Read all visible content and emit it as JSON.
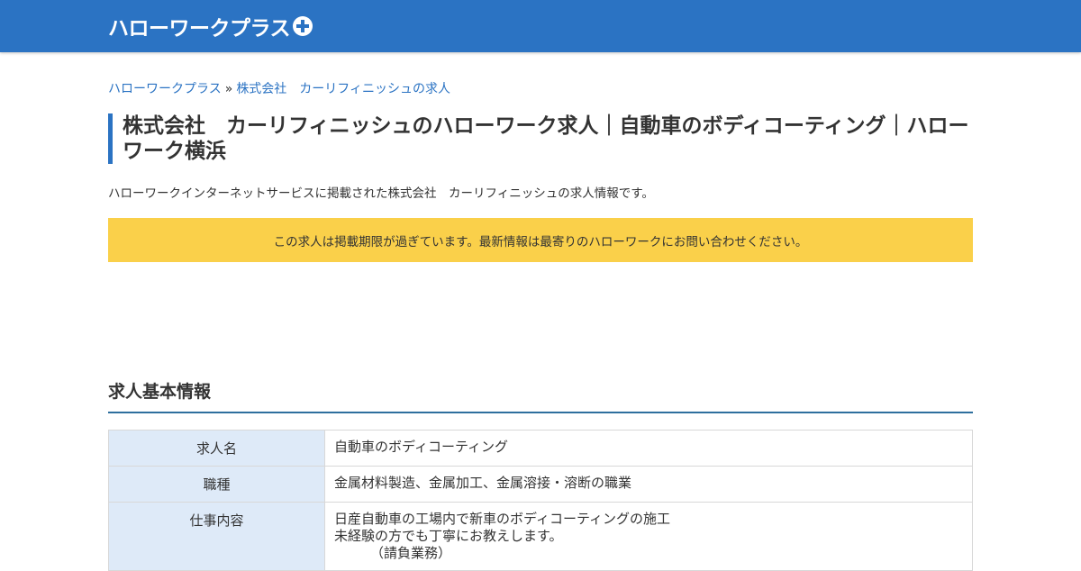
{
  "header": {
    "logo_text": "ハローワークプラス",
    "logo_icon": "plus-circle-icon",
    "brand_color": "#2b73c3"
  },
  "breadcrumb": {
    "home": "ハローワークプラス",
    "separator": "»",
    "current": "株式会社　カーリフィニッシュの求人"
  },
  "page": {
    "title": "株式会社　カーリフィニッシュのハローワーク求人｜自動車のボディコーティング｜ハローワーク横浜",
    "intro": "ハローワークインターネットサービスに掲載された株式会社　カーリフィニッシュの求人情報です。",
    "notice": "この求人は掲載期限が過ぎています。最新情報は最寄りのハローワークにお問い合わせください。",
    "notice_color": "#fad04a"
  },
  "section": {
    "heading": "求人基本情報"
  },
  "table": {
    "rows": [
      {
        "label": "求人名",
        "value": "自動車のボディコーティング"
      },
      {
        "label": "職種",
        "value": "金属材料製造、金属加工、金属溶接・溶断の職業"
      },
      {
        "label": "仕事内容",
        "lines": [
          "日産自動車の工場内で新車のボディコーティングの施工",
          "未経験の方でも丁寧にお教えします。",
          "（請負業務）"
        ]
      }
    ]
  }
}
